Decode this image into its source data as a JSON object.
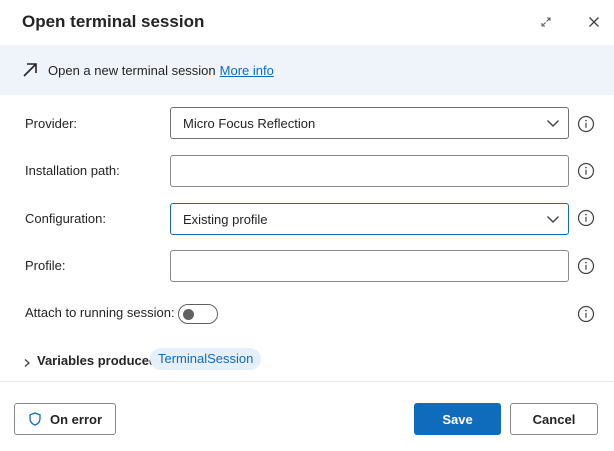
{
  "dialog": {
    "title": "Open terminal session",
    "expand_icon": "expand-icon",
    "close_icon": "close-icon"
  },
  "banner": {
    "icon": "arrow-up-right-icon",
    "description": "Open a new terminal session",
    "link_text": "More info"
  },
  "fields": {
    "provider": {
      "label": "Provider:",
      "value": "Micro Focus Reflection"
    },
    "installation_path": {
      "label": "Installation path:",
      "value": ""
    },
    "configuration": {
      "label": "Configuration:",
      "value": "Existing profile"
    },
    "profile": {
      "label": "Profile:",
      "value": ""
    },
    "attach": {
      "label": "Attach to running session:",
      "checked": false
    }
  },
  "variables": {
    "label": "Variables produced",
    "chip": "TerminalSession"
  },
  "footer": {
    "on_error_label": "On error",
    "save_label": "Save",
    "cancel_label": "Cancel"
  },
  "colors": {
    "accent": "#0f6cbd",
    "banner_bg": "#eff4fb",
    "chip_bg": "#e6f0fb"
  }
}
